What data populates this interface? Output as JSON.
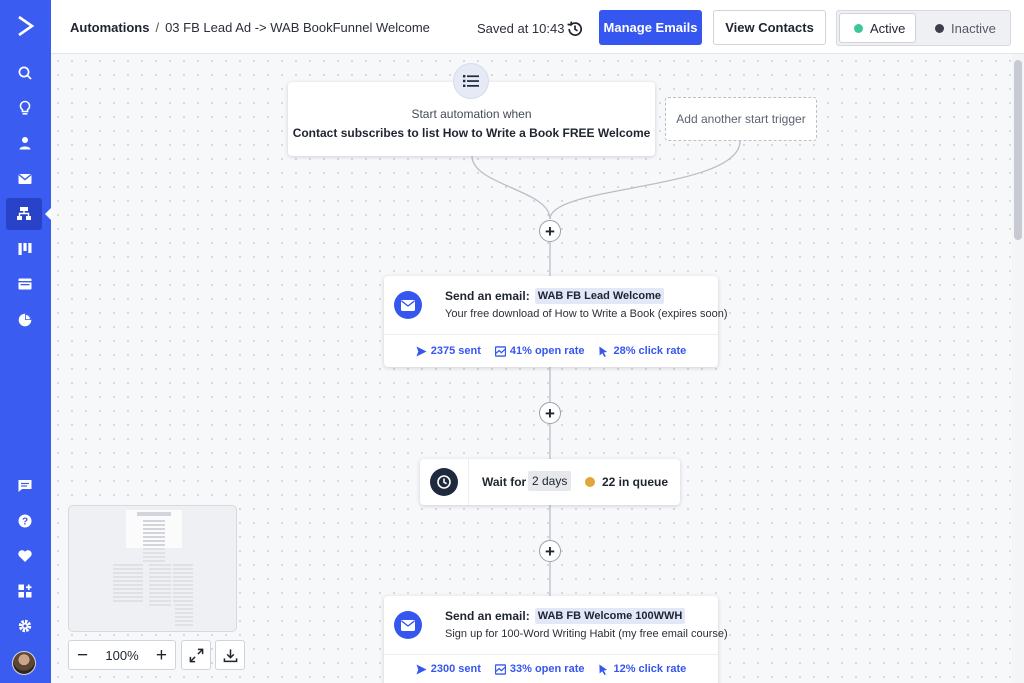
{
  "header": {
    "breadcrumb_root": "Automations",
    "breadcrumb_sep": "/",
    "breadcrumb_current": "03 FB Lead Ad -> WAB BookFunnel Welcome",
    "saved_text": "Saved at 10:43",
    "manage_emails_label": "Manage Emails",
    "view_contacts_label": "View Contacts",
    "status_active_label": "Active",
    "status_inactive_label": "Inactive"
  },
  "colors": {
    "brand_blue": "#3656f0",
    "active_dot": "#3fc59b",
    "inactive_dot": "#3a3f4a",
    "queue_dot": "#e0a63a"
  },
  "sidebar": {
    "top_items": [
      "logo-icon",
      "search-icon",
      "lightbulb-icon",
      "contacts-icon",
      "campaigns-icon",
      "automations-icon",
      "deals-icon",
      "site-icon",
      "reports-icon"
    ],
    "active_item": "automations-icon",
    "bottom_items": [
      "conversations-icon",
      "help-icon",
      "heart-icon",
      "apps-icon",
      "settings-icon",
      "avatar"
    ]
  },
  "trigger": {
    "line1": "Start automation when",
    "line2": "Contact subscribes to list How to Write a Book FREE Welcome",
    "add_trigger_label": "Add another start trigger"
  },
  "steps": {
    "email1": {
      "title_prefix": "Send an email:",
      "tag": "WAB FB Lead Welcome",
      "subject": "Your free download of How to Write a Book (expires soon)",
      "sent": "2375 sent",
      "open_rate": "41% open rate",
      "click_rate": "28% click rate"
    },
    "wait": {
      "label": "Wait for",
      "duration": "2 days",
      "queue": "22 in queue"
    },
    "email2": {
      "title_prefix": "Send an email:",
      "tag": "WAB FB Welcome 100WWH",
      "subject": "Sign up for 100-Word Writing Habit (my free email course)",
      "sent": "2300 sent",
      "open_rate": "33% open rate",
      "click_rate": "12% click rate"
    }
  },
  "zoom": {
    "level": "100%",
    "minus": "−",
    "plus": "+"
  }
}
